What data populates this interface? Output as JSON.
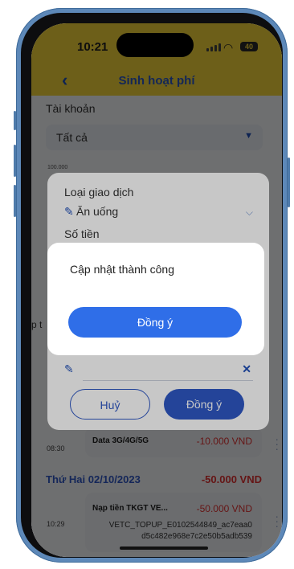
{
  "status_bar": {
    "time": "10:21",
    "battery": "40"
  },
  "header": {
    "back_icon": "chevron-left-icon",
    "title": "Sinh hoạt phí"
  },
  "filter": {
    "label": "Tài khoản",
    "value": "Tất cả"
  },
  "chart": {
    "top_tick": "100.000"
  },
  "transactions": {
    "item1": {
      "time": "08:30",
      "title": "Data 3G/4G/5G",
      "amount": "-10.000 VND"
    },
    "day2": {
      "date": "Thứ Hai 02/10/2023",
      "total": "-50.000 VND"
    },
    "item2": {
      "time": "10:29",
      "title": "Nạp tiền TKGT VE...",
      "amount": "-50.000 VND",
      "ref1": "VETC_TOPUP_E0102544849_ac7eaa0",
      "ref2": "d5c482e968e7c2e50b5adb539"
    },
    "partial_label": "p t"
  },
  "edit_sheet": {
    "type_label": "Loại giao dịch",
    "type_value": "Ăn uống",
    "amount_label": "Số tiền",
    "cancel_label": "Huỷ",
    "confirm_label": "Đồng ý"
  },
  "dialog": {
    "message": "Cập nhật thành công",
    "ok_label": "Đồng ý"
  },
  "colors": {
    "header_yellow": "#f2d33a",
    "primary_blue": "#2f58c4",
    "negative_red": "#e03131"
  }
}
